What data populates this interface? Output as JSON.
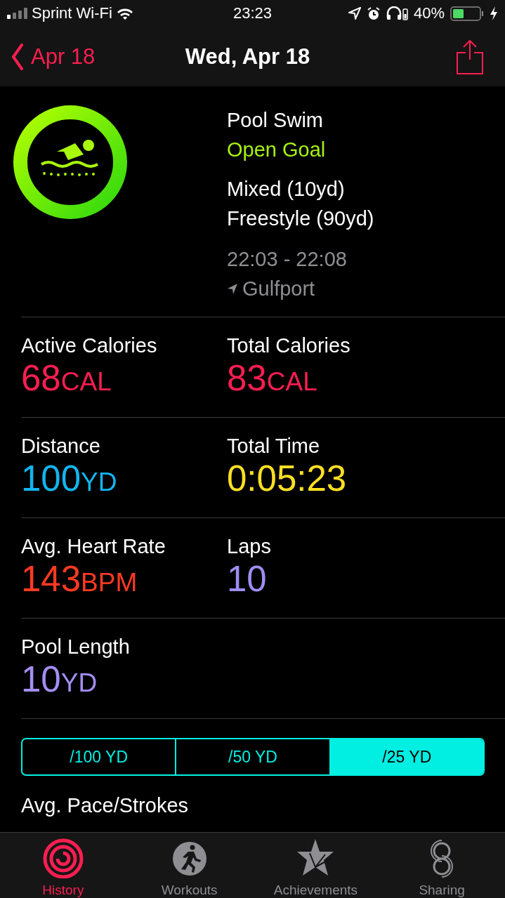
{
  "status_bar": {
    "carrier": "Sprint Wi-Fi",
    "time": "23:23",
    "battery": "40%"
  },
  "nav_bar": {
    "back": "Apr 18",
    "title": "Wed, Apr 18"
  },
  "workout": {
    "title": "Pool Swim",
    "goal": "Open Goal",
    "strokes": [
      "Mixed (10yd)",
      "Freestyle (90yd)"
    ],
    "time_range": "22:03 - 22:08",
    "location": "Gulfport"
  },
  "metric_rows": [
    [
      {
        "label": "Active Calories",
        "value": "68",
        "unit": "CAL",
        "color": "#fa1e50"
      },
      {
        "label": "Total Calories",
        "value": "83",
        "unit": "CAL",
        "color": "#fa1e50"
      }
    ],
    [
      {
        "label": "Distance",
        "value": "100",
        "unit": "YD",
        "color": "#12b5f0"
      },
      {
        "label": "Total Time",
        "value": "0:05:23",
        "color": "#fde022"
      }
    ],
    [
      {
        "label": "Avg. Heart Rate",
        "value": "143",
        "unit": "BPM",
        "color": "#fe3a22"
      },
      {
        "label": "Laps",
        "value": "10",
        "color": "#9e8ef2"
      }
    ],
    [
      {
        "label": "Pool Length",
        "value": "10",
        "unit": "YD",
        "color": "#a48ef5"
      }
    ]
  ],
  "pace_units": [
    {
      "label": "/100 YD",
      "selected": false
    },
    {
      "label": "/50 YD",
      "selected": false
    },
    {
      "label": "/25 YD",
      "selected": true
    }
  ],
  "pace_section": {
    "label": "Avg. Pace/Strokes"
  },
  "tabs": [
    {
      "label": "History",
      "selected": true
    },
    {
      "label": "Workouts",
      "selected": false
    },
    {
      "label": "Achievements",
      "selected": false
    },
    {
      "label": "Sharing",
      "selected": false
    }
  ]
}
